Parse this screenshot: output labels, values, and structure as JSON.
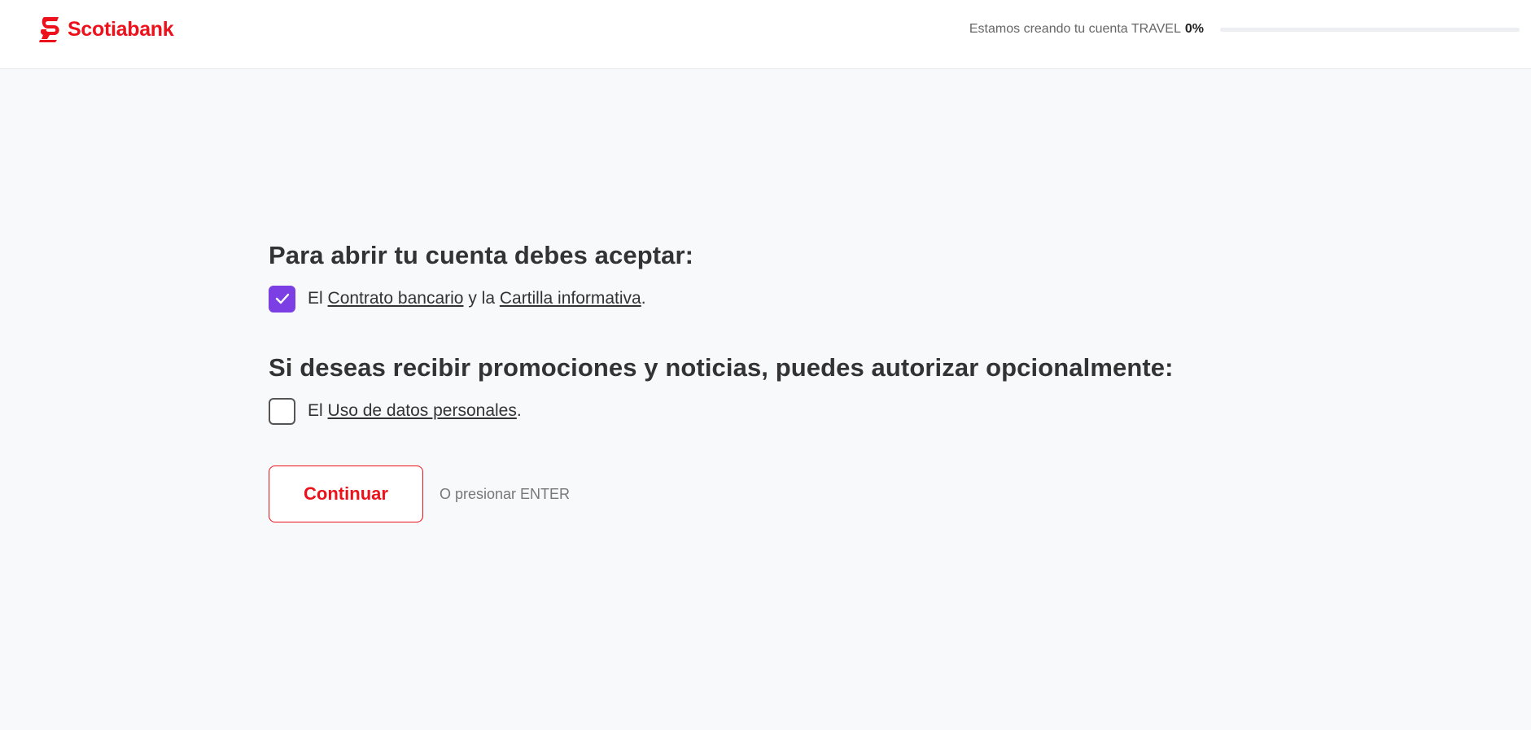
{
  "header": {
    "logo_text": "Scotiabank",
    "logo_icon": "scotiabank-s-logo",
    "progress_label": "Estamos creando tu cuenta TRAVEL",
    "progress_value": "0%",
    "progress_fraction": 0
  },
  "main": {
    "required": {
      "heading": "Para abrir tu cuenta debes aceptar:",
      "checked": true,
      "prefix": "El",
      "link1": "Contrato bancario",
      "middle": "y la",
      "link2": "Cartilla informativa",
      "suffix": "."
    },
    "optional": {
      "heading": "Si deseas recibir promociones y noticias, puedes autorizar opcionalmente:",
      "checked": false,
      "prefix": "El",
      "link": "Uso de datos personales",
      "suffix": "."
    },
    "continue_label": "Continuar",
    "enter_hint": "O presionar ENTER"
  },
  "colors": {
    "brand_red": "#ec111a",
    "checkbox_purple": "#7b3fe4",
    "background": "#f8f9fb"
  }
}
